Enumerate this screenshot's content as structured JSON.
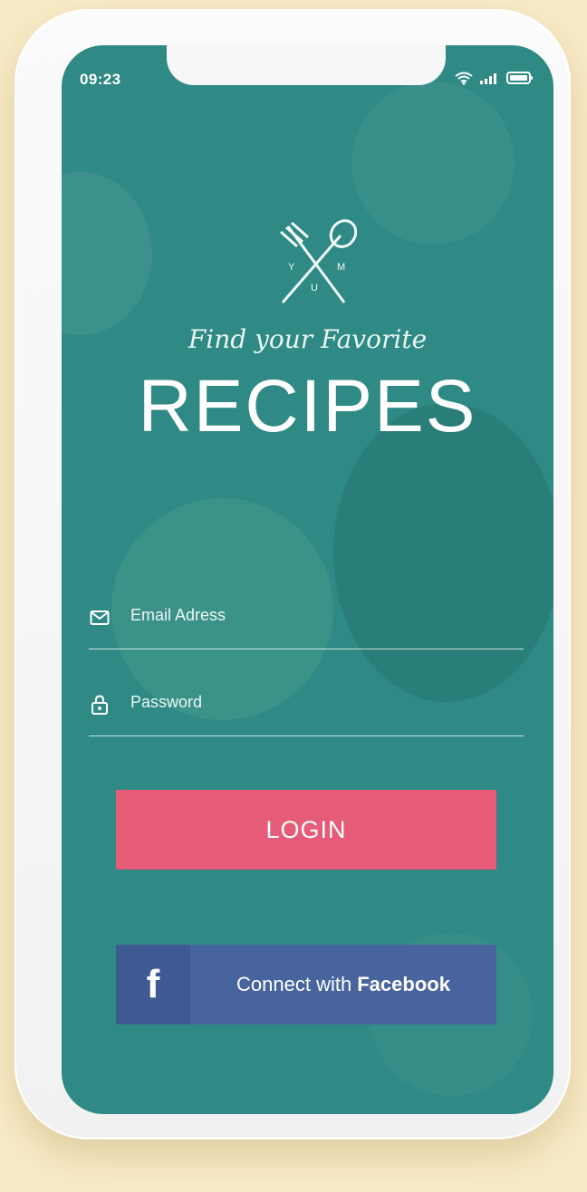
{
  "status_bar": {
    "time": "09:23"
  },
  "header": {
    "logo_letters": [
      "Y",
      "M",
      "U"
    ],
    "subtitle": "Find your Favorite",
    "title": "RECIPES"
  },
  "form": {
    "email": {
      "placeholder": "Email Adress",
      "value": ""
    },
    "password": {
      "placeholder": "Password",
      "value": ""
    }
  },
  "buttons": {
    "login_label": "LOGIN",
    "facebook_icon_label": "f",
    "facebook_prefix": "Connect with",
    "facebook_brand": "Facebook"
  },
  "colors": {
    "background": "#f8ebc7",
    "screen": "#2f8984",
    "login_button": "#e65b78",
    "facebook_button": "#48649e",
    "facebook_icon": "#3f5993"
  },
  "icons": {
    "status": [
      "wifi-icon",
      "signal-icon",
      "battery-icon"
    ],
    "email": "mail-icon",
    "password": "lock-icon",
    "logo": "fork-spoon-icon"
  }
}
